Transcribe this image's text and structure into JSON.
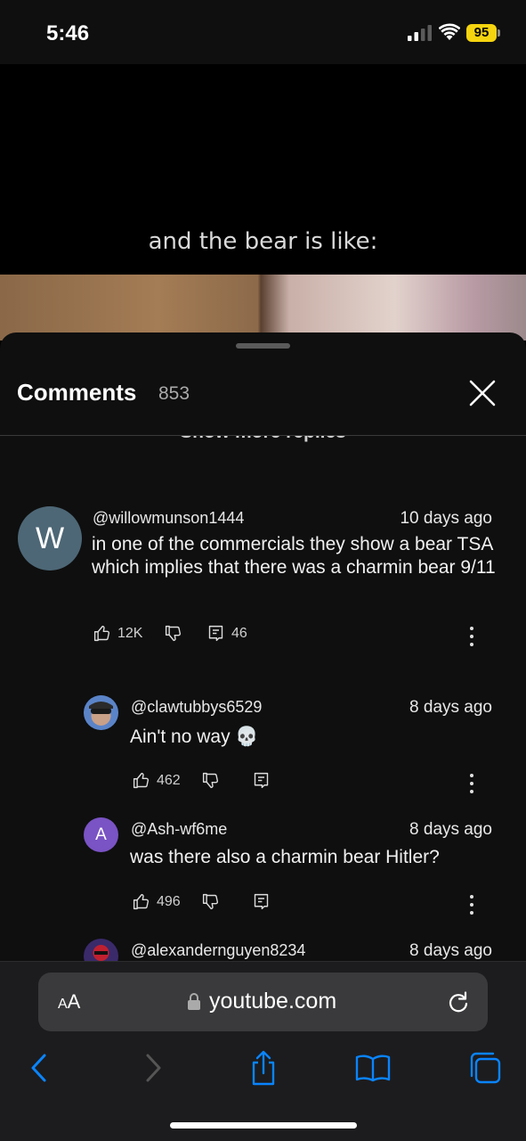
{
  "status_bar": {
    "time": "5:46",
    "battery": "95"
  },
  "video": {
    "caption": "and the bear is like:"
  },
  "comments_panel": {
    "title": "Comments",
    "count": "853",
    "show_more": "Show more replies",
    "comments": [
      {
        "avatar_letter": "W",
        "handle": "@willowmunson1444",
        "age": "10 days ago",
        "text": "in one of the commercials they show a bear TSA which implies that there was a charmin bear 9/11",
        "likes": "12K",
        "replies": "46"
      },
      {
        "handle": "@clawtubbys6529",
        "age": "8 days ago",
        "text": "Ain't no way 💀",
        "likes": "462"
      },
      {
        "avatar_letter": "A",
        "handle": "@Ash-wf6me",
        "age": "8 days ago",
        "text": "was there also a charmin bear Hitler?",
        "likes": "496"
      },
      {
        "handle": "@alexandernguyen8234",
        "age": "8 days ago"
      }
    ]
  },
  "browser": {
    "aa_small": "A",
    "aa_large": "A",
    "url": "youtube.com"
  },
  "colors": {
    "accent_blue": "#0a84ff",
    "avatar_w": "#4d6776",
    "avatar_a": "#7a53c4",
    "battery": "#f5d40f"
  }
}
